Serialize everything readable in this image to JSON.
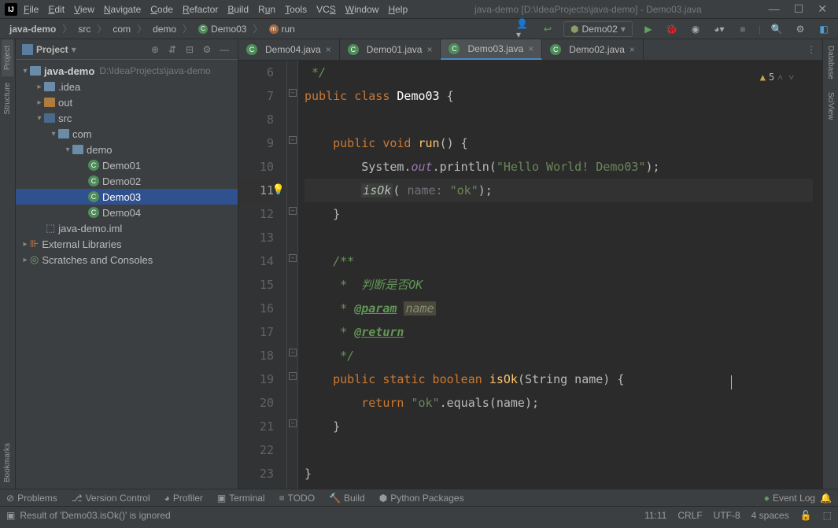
{
  "title": "java-demo [D:\\IdeaProjects\\java-demo] - Demo03.java",
  "menu": [
    "File",
    "Edit",
    "View",
    "Navigate",
    "Code",
    "Refactor",
    "Build",
    "Run",
    "Tools",
    "VCS",
    "Window",
    "Help"
  ],
  "breadcrumb": {
    "items": [
      "java-demo",
      "src",
      "com",
      "demo",
      "Demo03",
      "run"
    ]
  },
  "runConfig": "Demo02",
  "project": {
    "title": "Project",
    "root": "java-demo",
    "rootPath": "D:\\IdeaProjects\\java-demo",
    "tree": {
      "idea": ".idea",
      "out": "out",
      "src": "src",
      "com": "com",
      "demo": "demo",
      "files": [
        "Demo01",
        "Demo02",
        "Demo03",
        "Demo04"
      ],
      "iml": "java-demo.iml",
      "ext": "External Libraries",
      "scratch": "Scratches and Consoles"
    },
    "selected": "Demo03"
  },
  "tabs": [
    {
      "label": "Demo04.java",
      "active": false
    },
    {
      "label": "Demo01.java",
      "active": false
    },
    {
      "label": "Demo03.java",
      "active": true
    },
    {
      "label": "Demo02.java",
      "active": false
    }
  ],
  "warningCount": "5",
  "code": {
    "startLine": 6,
    "highlightLine": 11,
    "lines": {
      "l6": "*/",
      "l7": {
        "pre": "",
        "cls": "Demo03"
      },
      "l9": "run",
      "l10": {
        "sys": "System",
        "out": "out",
        "prn": "println",
        "str": "\"Hello World! Demo03\""
      },
      "l11": {
        "call": "isOk",
        "hint": "name:",
        "arg": "\"ok\""
      },
      "l14_c": "/**",
      "l15_c": " *  判断是否OK",
      "l16_tag": "@param",
      "l16_name": "name",
      "l17_tag": "@return",
      "l18_c": " */",
      "l19": {
        "fn": "isOk",
        "sig": "(String name) {"
      },
      "l20": {
        "ret": "return",
        "str": "\"ok\"",
        "eq": ".equals(name);"
      }
    }
  },
  "bottom": {
    "problems": "Problems",
    "vcs": "Version Control",
    "profiler": "Profiler",
    "terminal": "Terminal",
    "todo": "TODO",
    "build": "Build",
    "pypkg": "Python Packages",
    "eventlog": "Event Log"
  },
  "status": {
    "msg": "Result of 'Demo03.isOk()' is ignored",
    "pos": "11:11",
    "eol": "CRLF",
    "enc": "UTF-8",
    "indent": "4 spaces"
  },
  "sidebars": {
    "left": [
      "Project",
      "Structure",
      "Bookmarks"
    ],
    "right": [
      "Database",
      "SciView"
    ]
  }
}
